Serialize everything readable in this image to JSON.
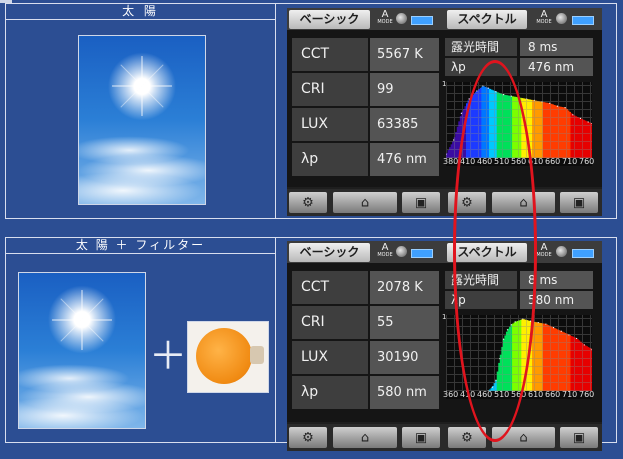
{
  "sections": [
    {
      "title": "太 陽",
      "filter": false,
      "device": {
        "tabs": {
          "basic": "ベーシック",
          "spectrum": "スペクトル"
        },
        "amode": {
          "letter": "A",
          "sub": "MODE"
        },
        "rows": [
          {
            "label": "CCT",
            "value": "5567 K"
          },
          {
            "label": "CRI",
            "value": "99"
          },
          {
            "label": "LUX",
            "value": "63385"
          },
          {
            "label": "λp",
            "value": "476 nm"
          }
        ],
        "info": [
          {
            "label": "露光時間",
            "value": "8 ms"
          },
          {
            "label": "λp",
            "value": "476 nm"
          }
        ],
        "chart_data": {
          "type": "area",
          "x": [
            380,
            400,
            420,
            440,
            460,
            476,
            490,
            510,
            530,
            550,
            570,
            590,
            610,
            630,
            650,
            670,
            690,
            710,
            730,
            750,
            760
          ],
          "values": [
            0.05,
            0.25,
            0.62,
            0.82,
            0.93,
            1.0,
            0.97,
            0.92,
            0.88,
            0.86,
            0.84,
            0.82,
            0.8,
            0.78,
            0.76,
            0.72,
            0.7,
            0.6,
            0.55,
            0.5,
            0.48
          ],
          "xlim": [
            380,
            760
          ],
          "ylim": [
            0,
            1
          ],
          "y_tick_label": "1",
          "tick_labels": [
            "380",
            "410",
            "460",
            "510",
            "560",
            "610",
            "660",
            "710",
            "760"
          ]
        }
      }
    },
    {
      "title": "太 陽 ＋ フィルター",
      "filter": true,
      "plus": "＋",
      "device": {
        "tabs": {
          "basic": "ベーシック",
          "spectrum": "スペクトル"
        },
        "amode": {
          "letter": "A",
          "sub": "MODE"
        },
        "rows": [
          {
            "label": "CCT",
            "value": "2078 K"
          },
          {
            "label": "CRI",
            "value": "55"
          },
          {
            "label": "LUX",
            "value": "30190"
          },
          {
            "label": "λp",
            "value": "580 nm"
          }
        ],
        "info": [
          {
            "label": "露光時間",
            "value": "8 ms"
          },
          {
            "label": "λp",
            "value": "580 nm"
          }
        ],
        "chart_data": {
          "type": "area",
          "x": [
            380,
            490,
            500,
            510,
            520,
            530,
            540,
            550,
            560,
            580,
            600,
            620,
            640,
            660,
            680,
            700,
            720,
            740,
            760
          ],
          "values": [
            0.0,
            0.0,
            0.05,
            0.15,
            0.45,
            0.72,
            0.85,
            0.92,
            0.96,
            1.0,
            0.97,
            0.95,
            0.93,
            0.88,
            0.83,
            0.78,
            0.73,
            0.64,
            0.58
          ],
          "xlim": [
            380,
            760
          ],
          "ylim": [
            0,
            1
          ],
          "y_tick_label": "1",
          "tick_labels": [
            "360",
            "410",
            "460",
            "510",
            "560",
            "610",
            "660",
            "710",
            "760"
          ]
        }
      }
    }
  ],
  "colors": {
    "background": "#2c4e93",
    "highlight": "#e0141e",
    "battery": "#3fa0ff"
  },
  "icons": {
    "settings": "gear-icon",
    "home": "home-icon",
    "save": "save-icon"
  }
}
